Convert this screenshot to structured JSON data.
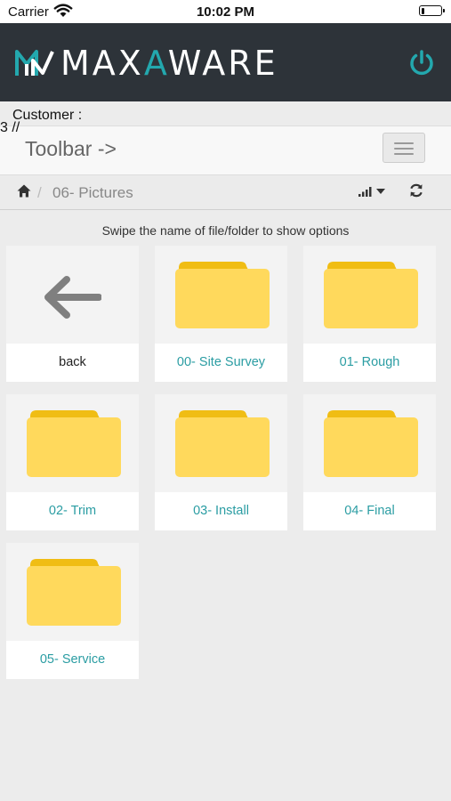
{
  "status_bar": {
    "carrier": "Carrier",
    "time": "10:02 PM"
  },
  "header": {
    "logo_white_1": "MAX",
    "logo_teal": "A",
    "logo_white_2": "WARE",
    "accent_color": "#23a8ae",
    "power_icon": "power-icon"
  },
  "customer_label": "Customer :",
  "stray_text": "3 //",
  "toolbar": {
    "brand": "Toolbar ->",
    "menu_icon": "hamburger-icon"
  },
  "breadcrumb": {
    "separator": "/",
    "current": "06- Pictures"
  },
  "hint": "Swipe the name of file/folder to show options",
  "items": [
    {
      "label": "back",
      "type": "back"
    },
    {
      "label": "00- Site Survey",
      "type": "folder"
    },
    {
      "label": "01- Rough",
      "type": "folder"
    },
    {
      "label": "02- Trim",
      "type": "folder"
    },
    {
      "label": "03- Install",
      "type": "folder"
    },
    {
      "label": "04- Final",
      "type": "folder"
    },
    {
      "label": "05- Service",
      "type": "folder"
    }
  ],
  "colors": {
    "folder_body": "#ffd95c",
    "folder_tab": "#f0bd14",
    "header_bg": "#2d3339",
    "link": "#2b9da3"
  }
}
